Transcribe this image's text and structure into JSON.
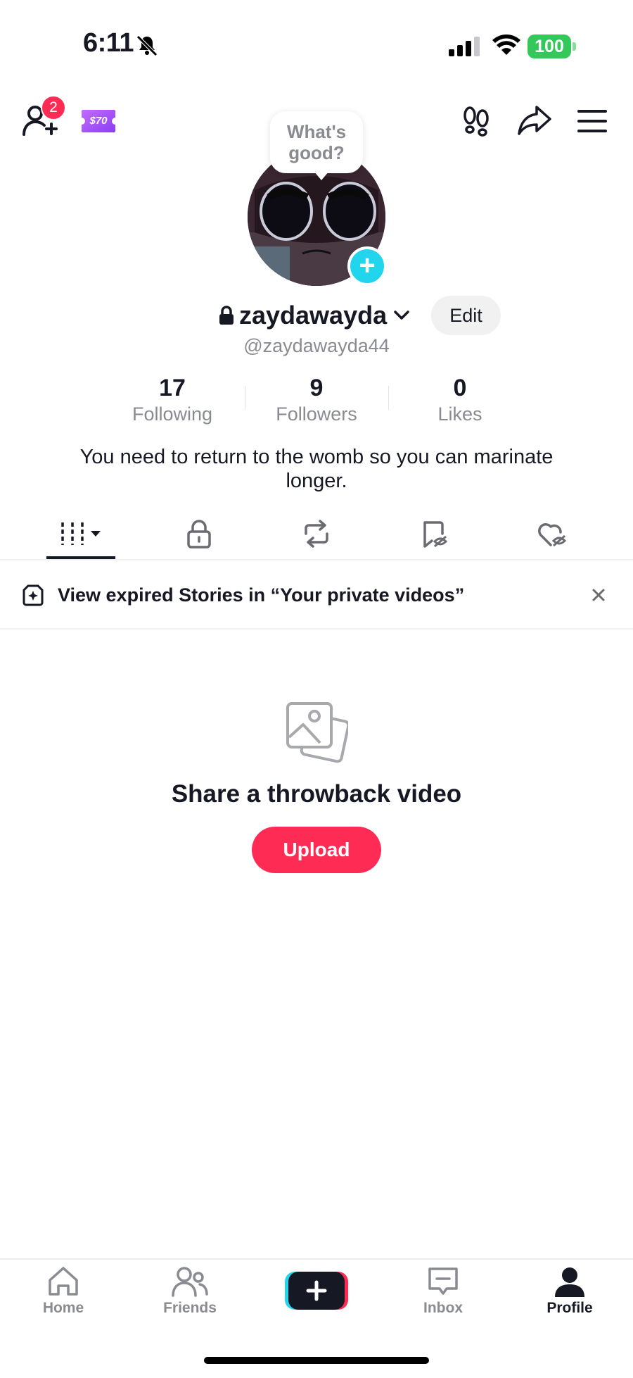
{
  "status_bar": {
    "time": "6:11",
    "battery": "100"
  },
  "toolbar": {
    "friend_requests_count": "2",
    "coupon_label": "$70"
  },
  "profile": {
    "bubble_text": "What's good?",
    "username": "zaydawayda",
    "edit_label": "Edit",
    "handle": "@zaydawayda44",
    "stats": [
      {
        "value": "17",
        "label": "Following"
      },
      {
        "value": "9",
        "label": "Followers"
      },
      {
        "value": "0",
        "label": "Likes"
      }
    ],
    "bio": "You need to return to the womb so you can marinate longer."
  },
  "banner": {
    "text": "View expired Stories in “Your private videos”"
  },
  "empty_state": {
    "title": "Share a throwback video",
    "button": "Upload"
  },
  "nav": [
    {
      "label": "Home",
      "icon": "home-icon"
    },
    {
      "label": "Friends",
      "icon": "friends-icon"
    },
    {
      "label": "",
      "icon": "create-icon"
    },
    {
      "label": "Inbox",
      "icon": "inbox-icon"
    },
    {
      "label": "Profile",
      "icon": "profile-icon"
    }
  ],
  "colors": {
    "accent": "#fe2c55",
    "cyan": "#20d5ec",
    "battery": "#34c759",
    "coupon": "#a855f7"
  }
}
